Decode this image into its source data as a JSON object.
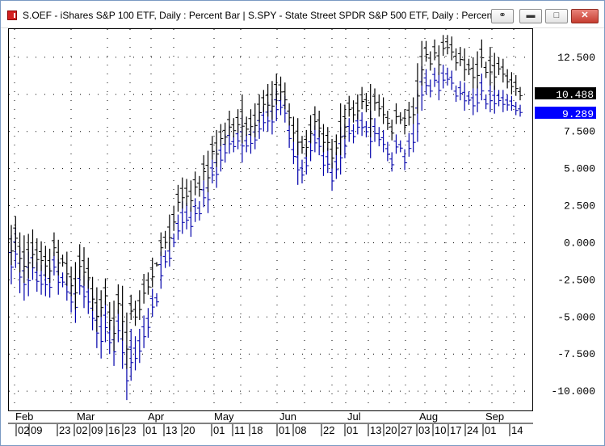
{
  "window": {
    "title": "S.OEF - iShares S&P 100 ETF, Daily : Percent Bar   |   S.SPY - State Street SPDR S&P 500 ETF, Daily : Percent Bar",
    "link_icon": "link-icon",
    "minimize_icon": "minimize-icon",
    "maximize_icon": "maximize-icon",
    "close_icon": "close-icon"
  },
  "chart_data": {
    "type": "bar",
    "subtype": "percent-ohlc",
    "title": "",
    "xlabel": "",
    "ylabel": "",
    "ylim": [
      -11.3,
      14.4
    ],
    "y_ticks": [
      12.5,
      10.0,
      7.5,
      5.0,
      2.5,
      0.0,
      -2.5,
      -5.0,
      -7.5,
      -10.0
    ],
    "y_tick_labels": [
      "12.500",
      "10.000",
      "7.500",
      "5.000",
      "2.500",
      "0.000",
      "-2.500",
      "-5.000",
      "-7.500",
      "-10.000"
    ],
    "grid": true,
    "months": [
      "Feb",
      "Mar",
      "Apr",
      "May",
      "Jun",
      "Jul",
      "Aug",
      "Sep"
    ],
    "date_labels": [
      "02",
      "09",
      "23",
      "02",
      "09",
      "16",
      "23",
      "01",
      "13",
      "20",
      "01",
      "11",
      "18",
      "01",
      "08",
      "22",
      "01",
      "13",
      "20",
      "27",
      "03",
      "10",
      "17",
      "24",
      "01",
      "14"
    ],
    "last_values": [
      {
        "label": "10.488",
        "value": 10.488,
        "color": "#000000"
      },
      {
        "label": "9.289",
        "value": 9.289,
        "color": "#0000ff"
      }
    ],
    "series": [
      {
        "name": "S.OEF",
        "color": "#000000",
        "points": [
          [
            1.2,
            -1.5
          ],
          [
            1.8,
            -0.5
          ],
          [
            0.7,
            -2.0
          ],
          [
            0.5,
            -2.7
          ],
          [
            0.6,
            -2.4
          ],
          [
            0.9,
            -1.7
          ],
          [
            0.3,
            -1.9
          ],
          [
            0.1,
            -1.9
          ],
          [
            -0.2,
            -2.3
          ],
          [
            -0.4,
            -2.7
          ],
          [
            0.7,
            -0.9
          ],
          [
            0.2,
            -2.2
          ],
          [
            -0.8,
            -1.6
          ],
          [
            -0.6,
            -2.9
          ],
          [
            -1.6,
            -3.6
          ],
          [
            -1.3,
            -4.5
          ],
          [
            -0.1,
            -2.4
          ],
          [
            -0.3,
            -2.9
          ],
          [
            -1.0,
            -3.1
          ],
          [
            -2.3,
            -4.6
          ],
          [
            -3.0,
            -6.0
          ],
          [
            -3.2,
            -5.0
          ],
          [
            -2.4,
            -4.2
          ],
          [
            -4.0,
            -5.9
          ],
          [
            -3.9,
            -7.3
          ],
          [
            -2.8,
            -4.8
          ],
          [
            -2.9,
            -6.6
          ],
          [
            -4.7,
            -8.5
          ],
          [
            -3.5,
            -5.2
          ],
          [
            -3.9,
            -5.6
          ],
          [
            -3.2,
            -5.2
          ],
          [
            -2.1,
            -4.1
          ],
          [
            -2.0,
            -3.5
          ],
          [
            -1.0,
            -3.0
          ],
          [
            -1.3,
            -1.6
          ],
          [
            0.7,
            -0.9
          ],
          [
            0.8,
            -0.4
          ],
          [
            1.9,
            -0.5
          ],
          [
            2.5,
            0.8
          ],
          [
            3.9,
            2.1
          ],
          [
            4.4,
            2.3
          ],
          [
            4.3,
            2.5
          ],
          [
            4.2,
            2.1
          ],
          [
            4.8,
            3.2
          ],
          [
            4.5,
            3.1
          ],
          [
            5.9,
            4.2
          ],
          [
            6.2,
            3.4
          ],
          [
            7.2,
            5.6
          ],
          [
            7.6,
            5.1
          ],
          [
            8.0,
            6.5
          ],
          [
            8.1,
            6.6
          ],
          [
            8.9,
            7.2
          ],
          [
            8.4,
            7.1
          ],
          [
            9.0,
            7.4
          ],
          [
            10.0,
            6.7
          ],
          [
            8.5,
            7.2
          ],
          [
            9.0,
            7.2
          ],
          [
            9.4,
            7.1
          ],
          [
            10.0,
            8.1
          ],
          [
            10.3,
            8.8
          ],
          [
            10.7,
            8.5
          ],
          [
            10.9,
            8.3
          ],
          [
            11.4,
            9.3
          ],
          [
            11.2,
            9.6
          ],
          [
            10.8,
            9.0
          ],
          [
            9.4,
            7.9
          ],
          [
            8.5,
            6.8
          ],
          [
            8.4,
            5.9
          ],
          [
            7.2,
            6.0
          ],
          [
            7.6,
            5.8
          ],
          [
            8.6,
            6.7
          ],
          [
            9.2,
            7.6
          ],
          [
            8.9,
            7.1
          ],
          [
            8.0,
            6.1
          ],
          [
            7.8,
            6.2
          ],
          [
            7.0,
            5.0
          ],
          [
            7.3,
            5.9
          ],
          [
            9.4,
            5.9
          ],
          [
            9.3,
            7.0
          ],
          [
            9.9,
            8.5
          ],
          [
            9.6,
            8.1
          ],
          [
            10.0,
            8.3
          ],
          [
            10.5,
            9.0
          ],
          [
            10.1,
            8.8
          ],
          [
            10.7,
            7.1
          ],
          [
            10.4,
            8.9
          ],
          [
            10.0,
            8.5
          ],
          [
            9.8,
            8.0
          ],
          [
            8.9,
            7.6
          ],
          [
            8.3,
            6.9
          ],
          [
            9.4,
            8.0
          ],
          [
            8.8,
            8.0
          ],
          [
            9.0,
            7.3
          ],
          [
            9.5,
            7.9
          ],
          [
            9.8,
            8.0
          ],
          [
            12.1,
            8.7
          ],
          [
            13.6,
            10.6
          ],
          [
            13.6,
            12.2
          ],
          [
            12.9,
            11.6
          ],
          [
            13.7,
            12.3
          ],
          [
            13.3,
            11.3
          ],
          [
            14.0,
            12.6
          ],
          [
            14.0,
            12.7
          ],
          [
            13.9,
            12.3
          ],
          [
            13.1,
            11.6
          ],
          [
            13.2,
            11.9
          ],
          [
            13.1,
            10.9
          ],
          [
            12.4,
            11.3
          ],
          [
            12.5,
            10.4
          ],
          [
            12.9,
            10.4
          ],
          [
            13.7,
            11.8
          ],
          [
            12.2,
            11.1
          ],
          [
            13.2,
            10.6
          ],
          [
            12.8,
            10.3
          ],
          [
            12.5,
            11.3
          ],
          [
            12.4,
            10.8
          ],
          [
            11.7,
            10.4
          ],
          [
            11.5,
            10.0
          ],
          [
            11.3,
            9.9
          ],
          [
            10.5,
            9.6
          ]
        ]
      },
      {
        "name": "S.SPY",
        "color": "#0000aa",
        "points": [
          [
            0.5,
            -2.8
          ],
          [
            1.0,
            -1.7
          ],
          [
            -0.3,
            -3.4
          ],
          [
            -0.8,
            -3.9
          ],
          [
            -0.6,
            -3.6
          ],
          [
            -0.2,
            -2.5
          ],
          [
            -1.3,
            -3.3
          ],
          [
            -1.5,
            -3.5
          ],
          [
            -1.4,
            -3.6
          ],
          [
            -1.7,
            -3.7
          ],
          [
            -0.6,
            -2.2
          ],
          [
            -1.1,
            -3.5
          ],
          [
            -2.0,
            -3.0
          ],
          [
            -2.2,
            -3.9
          ],
          [
            -2.7,
            -4.7
          ],
          [
            -2.4,
            -5.4
          ],
          [
            -1.8,
            -3.5
          ],
          [
            -2.2,
            -4.4
          ],
          [
            -2.5,
            -4.8
          ],
          [
            -3.6,
            -5.9
          ],
          [
            -4.2,
            -7.1
          ],
          [
            -4.5,
            -7.8
          ],
          [
            -3.9,
            -6.7
          ],
          [
            -5.3,
            -7.5
          ],
          [
            -5.6,
            -8.3
          ],
          [
            -4.5,
            -6.7
          ],
          [
            -5.4,
            -8.5
          ],
          [
            -6.9,
            -10.6
          ],
          [
            -5.8,
            -9.3
          ],
          [
            -6.3,
            -8.6
          ],
          [
            -5.8,
            -8.1
          ],
          [
            -4.9,
            -7.1
          ],
          [
            -4.4,
            -6.4
          ],
          [
            -3.1,
            -5.0
          ],
          [
            -3.4,
            -4.3
          ],
          [
            -0.6,
            -3.1
          ],
          [
            -0.5,
            -1.7
          ],
          [
            0.0,
            -1.6
          ],
          [
            0.6,
            -0.3
          ],
          [
            1.9,
            0.2
          ],
          [
            2.8,
            0.6
          ],
          [
            2.7,
            0.9
          ],
          [
            2.4,
            0.4
          ],
          [
            3.0,
            1.4
          ],
          [
            2.8,
            1.5
          ],
          [
            4.2,
            2.4
          ],
          [
            4.6,
            2.0
          ],
          [
            5.6,
            4.0
          ],
          [
            6.3,
            3.7
          ],
          [
            7.0,
            4.8
          ],
          [
            7.3,
            5.4
          ],
          [
            7.9,
            6.0
          ],
          [
            7.2,
            6.1
          ],
          [
            7.9,
            6.3
          ],
          [
            8.6,
            5.4
          ],
          [
            7.3,
            6.1
          ],
          [
            8.0,
            6.0
          ],
          [
            8.1,
            6.3
          ],
          [
            8.9,
            7.0
          ],
          [
            9.2,
            7.5
          ],
          [
            9.5,
            7.5
          ],
          [
            9.7,
            7.3
          ],
          [
            10.4,
            8.2
          ],
          [
            10.1,
            8.6
          ],
          [
            9.9,
            8.1
          ],
          [
            8.2,
            6.4
          ],
          [
            6.8,
            5.3
          ],
          [
            6.8,
            3.9
          ],
          [
            5.6,
            4.0
          ],
          [
            6.3,
            4.6
          ],
          [
            7.5,
            5.5
          ],
          [
            7.9,
            6.1
          ],
          [
            7.6,
            5.9
          ],
          [
            6.6,
            4.5
          ],
          [
            6.4,
            4.7
          ],
          [
            5.4,
            3.5
          ],
          [
            6.1,
            4.3
          ],
          [
            7.8,
            4.6
          ],
          [
            8.0,
            5.7
          ],
          [
            8.4,
            6.8
          ],
          [
            8.0,
            6.7
          ],
          [
            8.7,
            7.3
          ],
          [
            8.8,
            7.2
          ],
          [
            8.2,
            7.1
          ],
          [
            8.9,
            5.7
          ],
          [
            8.4,
            6.8
          ],
          [
            7.8,
            6.5
          ],
          [
            7.6,
            6.1
          ],
          [
            6.8,
            5.5
          ],
          [
            6.1,
            4.8
          ],
          [
            7.3,
            6.0
          ],
          [
            6.9,
            6.1
          ],
          [
            6.3,
            4.9
          ],
          [
            7.4,
            5.8
          ],
          [
            8.0,
            6.1
          ],
          [
            10.3,
            6.8
          ],
          [
            11.9,
            8.9
          ],
          [
            11.7,
            10.0
          ],
          [
            11.0,
            9.8
          ],
          [
            11.8,
            10.5
          ],
          [
            11.5,
            9.6
          ],
          [
            12.0,
            10.4
          ],
          [
            11.8,
            10.6
          ],
          [
            11.6,
            10.3
          ],
          [
            10.6,
            9.5
          ],
          [
            10.9,
            9.6
          ],
          [
            10.8,
            8.9
          ],
          [
            10.2,
            9.3
          ],
          [
            10.4,
            8.6
          ],
          [
            10.6,
            8.8
          ],
          [
            11.4,
            9.6
          ],
          [
            10.0,
            9.0
          ],
          [
            11.0,
            8.8
          ],
          [
            10.6,
            8.7
          ],
          [
            10.3,
            9.2
          ],
          [
            10.3,
            8.8
          ],
          [
            10.0,
            8.9
          ],
          [
            9.9,
            8.9
          ],
          [
            9.5,
            8.6
          ],
          [
            9.3,
            8.5
          ]
        ]
      }
    ]
  }
}
